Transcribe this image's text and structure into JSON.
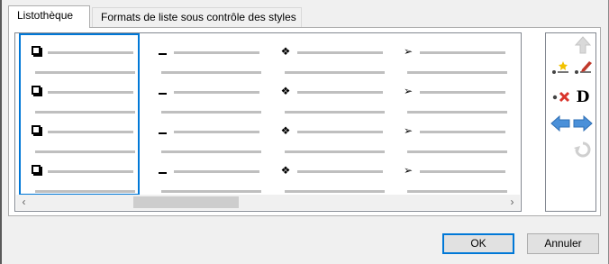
{
  "tabs": [
    {
      "label": "Listothèque",
      "active": true
    },
    {
      "label": "Formats de liste sous contrôle des styles",
      "active": false
    }
  ],
  "gallery": {
    "columns": [
      {
        "bullet_icon": "hollow-square-bullet-icon",
        "selected": true
      },
      {
        "bullet_icon": "dash-bullet-icon",
        "selected": false
      },
      {
        "bullet_icon": "four-diamond-bullet-icon",
        "glyph": "❖",
        "selected": false
      },
      {
        "bullet_icon": "arrowhead-bullet-icon",
        "glyph": "➢",
        "selected": false
      }
    ]
  },
  "toolbox": {
    "icons": [
      "move-up-arrow-icon",
      "add-bullet-icon",
      "edit-bullet-icon",
      "delete-bullet-icon",
      "default-d-icon",
      "arrow-left-icon",
      "arrow-right-icon",
      "reset-icon"
    ],
    "default_glyph": "D",
    "colors": {
      "accent_blue": "#4a90d9",
      "delete_red": "#d9342b",
      "star_yellow": "#f2c200",
      "pencil_red": "#c0392b"
    }
  },
  "buttons": {
    "ok": "OK",
    "cancel": "Annuler"
  },
  "colors": {
    "selection": "#0078d7",
    "placeholder_line": "#bfbfbf"
  }
}
